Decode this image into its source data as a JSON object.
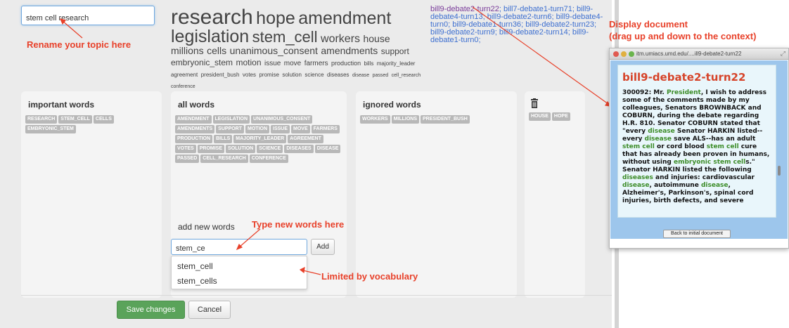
{
  "topic": {
    "value": "stem cell research"
  },
  "cloud": [
    {
      "text": "research",
      "size": 30
    },
    {
      "text": "hope",
      "size": 25
    },
    {
      "text": "amendment",
      "size": 25
    },
    {
      "text": "legislation",
      "size": 25
    },
    {
      "text": "stem_cell",
      "size": 22
    },
    {
      "text": "workers",
      "size": 16
    },
    {
      "text": "house",
      "size": 14
    },
    {
      "text": "millions",
      "size": 14
    },
    {
      "text": "cells",
      "size": 14
    },
    {
      "text": "unanimous_consent",
      "size": 14
    },
    {
      "text": "amendments",
      "size": 14
    },
    {
      "text": "support",
      "size": 12
    },
    {
      "text": "embryonic_stem",
      "size": 12
    },
    {
      "text": "motion",
      "size": 12
    },
    {
      "text": "issue",
      "size": 10
    },
    {
      "text": "move",
      "size": 10
    },
    {
      "text": "farmers",
      "size": 10
    },
    {
      "text": "production",
      "size": 9
    },
    {
      "text": "bills",
      "size": 8
    },
    {
      "text": "majority_leader",
      "size": 8
    },
    {
      "text": "agreement",
      "size": 8
    },
    {
      "text": "president_bush",
      "size": 8
    },
    {
      "text": "votes",
      "size": 8
    },
    {
      "text": "promise",
      "size": 8
    },
    {
      "text": "solution",
      "size": 8
    },
    {
      "text": "science",
      "size": 8
    },
    {
      "text": "diseases",
      "size": 8
    },
    {
      "text": "disease",
      "size": 7
    },
    {
      "text": "passed",
      "size": 7
    },
    {
      "text": "cell_research",
      "size": 7
    },
    {
      "text": "conference",
      "size": 7
    }
  ],
  "links": [
    {
      "text": "bill9-debate2-turn22",
      "visited": true
    },
    {
      "text": "bill7-debate1-turn71",
      "visited": false
    },
    {
      "text": "bill9-debate4-turn13",
      "visited": false
    },
    {
      "text": "bill9-debate2-turn6",
      "visited": false
    },
    {
      "text": "bill9-debate4-turn0",
      "visited": false
    },
    {
      "text": "bill9-debate1-turn36",
      "visited": false
    },
    {
      "text": "bill9-debate2-turn23",
      "visited": false
    },
    {
      "text": "bill9-debate2-turn9",
      "visited": false
    },
    {
      "text": "bill9-debate2-turn14",
      "visited": false
    },
    {
      "text": "bill9-debate1-turn0",
      "visited": false
    }
  ],
  "columns": {
    "important": {
      "title": "important words",
      "tags": [
        "RESEARCH",
        "STEM_CELL",
        "CELLS",
        "EMBRYONIC_STEM"
      ]
    },
    "all": {
      "title": "all words",
      "tags": [
        "AMENDMENT",
        "LEGISLATION",
        "UNANIMOUS_CONSENT",
        "AMENDMENTS",
        "SUPPORT",
        "MOTION",
        "ISSUE",
        "MOVE",
        "FARMERS",
        "PRODUCTION",
        "BILLS",
        "MAJORITY_LEADER",
        "AGREEMENT",
        "VOTES",
        "PROMISE",
        "SOLUTION",
        "SCIENCE",
        "DISEASES",
        "DISEASE",
        "PASSED",
        "CELL_RESEARCH",
        "CONFERENCE"
      ]
    },
    "ignored": {
      "title": "ignored words",
      "tags": [
        "WORKERS",
        "MILLIONS",
        "PRESIDENT_BUSH"
      ]
    },
    "trash": {
      "tags": [
        "HOUSE",
        "HOPE"
      ]
    }
  },
  "add_words": {
    "label": "add new words",
    "value": "stem_ce",
    "button": "Add",
    "suggestions": [
      "stem_cell",
      "stem_cells"
    ]
  },
  "footer": {
    "save": "Save changes",
    "cancel": "Cancel"
  },
  "annotations": {
    "rename": "Rename your topic here",
    "type_new": "Type new words here",
    "limited": "Limited by vocabulary",
    "display_line1": "Display document",
    "display_line2": "(drag up and down to the context)"
  },
  "doc": {
    "url": "itm.umiacs.umd.edu/....ill9-debate2-turn22",
    "heading": "bill9-debate2-turn22",
    "segments": [
      {
        "t": "300092: Mr. "
      },
      {
        "t": "President",
        "hl": true
      },
      {
        "t": ", I wish to address some of the comments made by my colleagues, Senators BROWNBACK and COBURN, during the debate regarding H.R. 810. Senator COBURN stated that \"every "
      },
      {
        "t": "disease",
        "hl": true
      },
      {
        "t": " Senator HARKIN listed--every "
      },
      {
        "t": "disease",
        "hl": true
      },
      {
        "t": " save ALS--has an adult "
      },
      {
        "t": "stem cell",
        "hl": true
      },
      {
        "t": " or cord blood "
      },
      {
        "t": "stem cell",
        "hl": true
      },
      {
        "t": " cure that has already been proven in humans, without using "
      },
      {
        "t": "embryonic stem cell",
        "hl": true
      },
      {
        "t": "s.\" Senator HARKIN listed the following "
      },
      {
        "t": "diseases",
        "hl": true
      },
      {
        "t": " and injuries: cardiovascular "
      },
      {
        "t": "disease",
        "hl": true
      },
      {
        "t": ", autoimmune "
      },
      {
        "t": "disease",
        "hl": true
      },
      {
        "t": ", Alzheimer's, Parkinson's, spinal cord injuries, birth defects, and severe"
      }
    ],
    "back": "Back to initial document"
  },
  "colors": {
    "annotation": "#e8412a",
    "link": "#3d6fd0",
    "visited": "#7a3c9a",
    "save": "#5aa35a",
    "doc_heading": "#d6442a",
    "highlight": "#3c8c28"
  }
}
